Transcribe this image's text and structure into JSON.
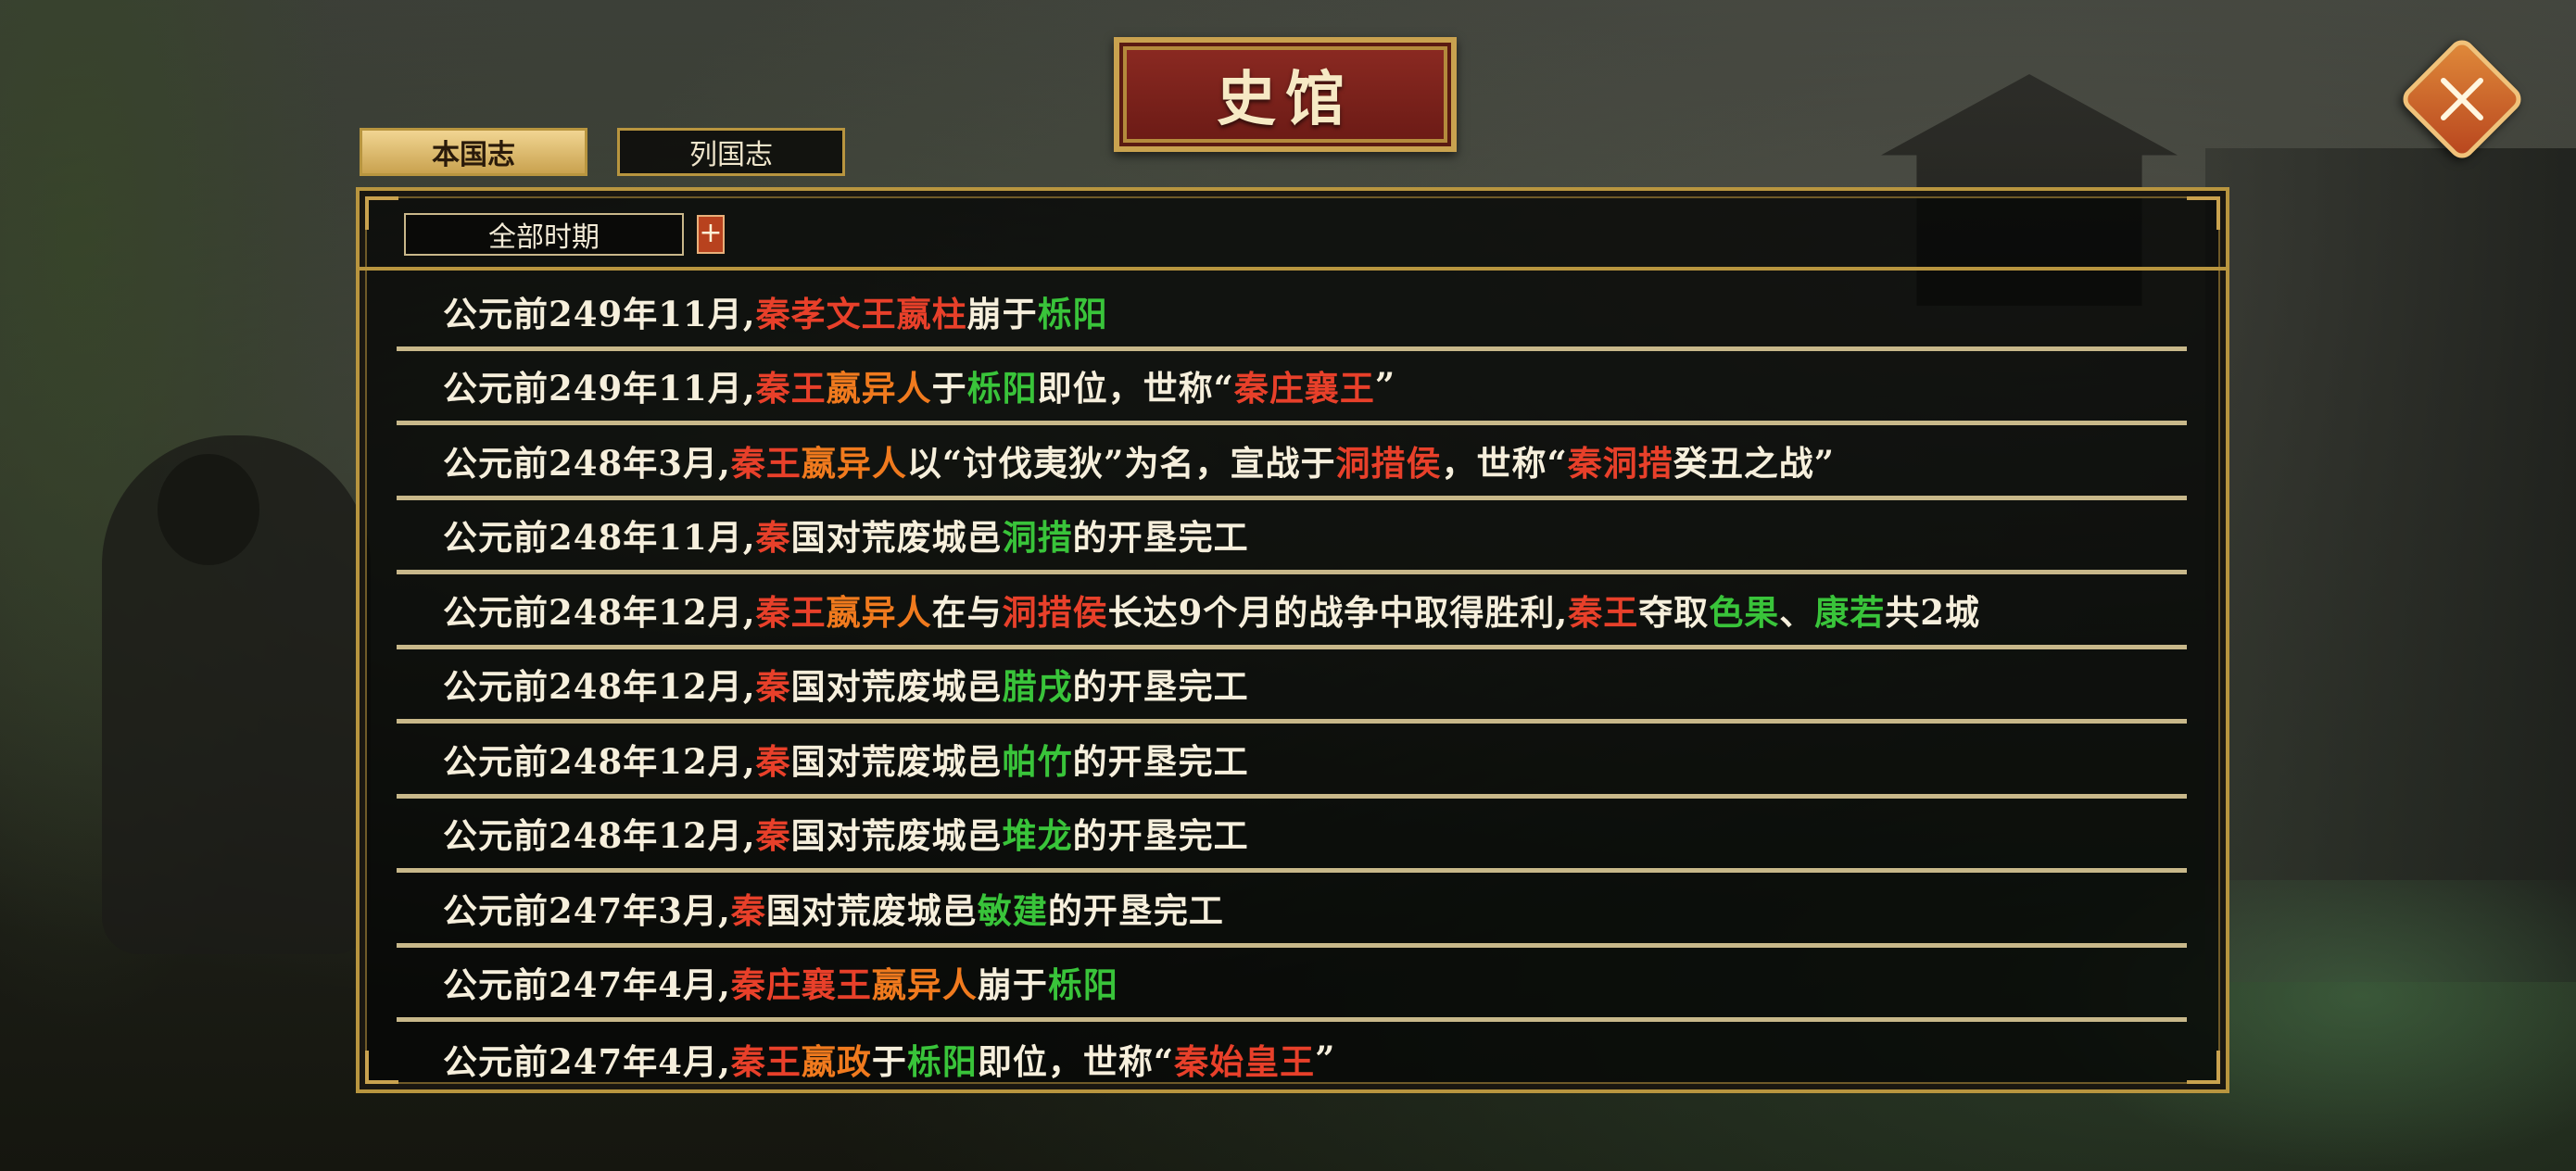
{
  "title": "史馆",
  "tabs": [
    {
      "label": "本国志",
      "active": true
    },
    {
      "label": "列国志",
      "active": false
    }
  ],
  "filter": {
    "period_label": "全部时期",
    "expand_label": "+"
  },
  "colors": {
    "white": "#f6efdc",
    "red": "#e8402a",
    "orange": "#f07a1e",
    "green": "#39c43a",
    "gold": "#b8953f"
  },
  "entries": [
    [
      {
        "t": "公元前249年11月,",
        "c": "w"
      },
      {
        "t": "秦孝文王嬴柱",
        "c": "r"
      },
      {
        "t": "崩于",
        "c": "w"
      },
      {
        "t": "栎阳",
        "c": "g"
      }
    ],
    [
      {
        "t": "公元前249年11月,",
        "c": "w"
      },
      {
        "t": "秦王",
        "c": "r"
      },
      {
        "t": "嬴异人",
        "c": "o"
      },
      {
        "t": "于",
        "c": "w"
      },
      {
        "t": "栎阳",
        "c": "g"
      },
      {
        "t": "即位，世称“",
        "c": "w"
      },
      {
        "t": "秦庄襄王",
        "c": "r"
      },
      {
        "t": "”",
        "c": "w"
      }
    ],
    [
      {
        "t": "公元前248年3月,",
        "c": "w"
      },
      {
        "t": "秦王",
        "c": "r"
      },
      {
        "t": "嬴异人",
        "c": "o"
      },
      {
        "t": "以“讨伐夷狄”为名，宣战于",
        "c": "w"
      },
      {
        "t": "洞措侯",
        "c": "r"
      },
      {
        "t": "，世称“",
        "c": "w"
      },
      {
        "t": "秦洞措",
        "c": "r"
      },
      {
        "t": "癸丑之战”",
        "c": "w"
      }
    ],
    [
      {
        "t": "公元前248年11月,",
        "c": "w"
      },
      {
        "t": "秦",
        "c": "r"
      },
      {
        "t": "国对荒废城邑",
        "c": "w"
      },
      {
        "t": "洞措",
        "c": "g"
      },
      {
        "t": "的开垦完工",
        "c": "w"
      }
    ],
    [
      {
        "t": "公元前248年12月,",
        "c": "w"
      },
      {
        "t": "秦王",
        "c": "r"
      },
      {
        "t": "嬴异人",
        "c": "o"
      },
      {
        "t": "在与",
        "c": "w"
      },
      {
        "t": "洞措侯",
        "c": "r"
      },
      {
        "t": "长达9个月的战争中取得胜利,",
        "c": "w"
      },
      {
        "t": "秦王",
        "c": "r"
      },
      {
        "t": "夺取",
        "c": "w"
      },
      {
        "t": "色果",
        "c": "g"
      },
      {
        "t": "、",
        "c": "w"
      },
      {
        "t": "康若",
        "c": "g"
      },
      {
        "t": "共2城",
        "c": "w"
      }
    ],
    [
      {
        "t": "公元前248年12月,",
        "c": "w"
      },
      {
        "t": "秦",
        "c": "r"
      },
      {
        "t": "国对荒废城邑",
        "c": "w"
      },
      {
        "t": "腊戌",
        "c": "g"
      },
      {
        "t": "的开垦完工",
        "c": "w"
      }
    ],
    [
      {
        "t": "公元前248年12月,",
        "c": "w"
      },
      {
        "t": "秦",
        "c": "r"
      },
      {
        "t": "国对荒废城邑",
        "c": "w"
      },
      {
        "t": "帕竹",
        "c": "g"
      },
      {
        "t": "的开垦完工",
        "c": "w"
      }
    ],
    [
      {
        "t": "公元前248年12月,",
        "c": "w"
      },
      {
        "t": "秦",
        "c": "r"
      },
      {
        "t": "国对荒废城邑",
        "c": "w"
      },
      {
        "t": "堆龙",
        "c": "g"
      },
      {
        "t": "的开垦完工",
        "c": "w"
      }
    ],
    [
      {
        "t": "公元前247年3月,",
        "c": "w"
      },
      {
        "t": "秦",
        "c": "r"
      },
      {
        "t": "国对荒废城邑",
        "c": "w"
      },
      {
        "t": "敏建",
        "c": "g"
      },
      {
        "t": "的开垦完工",
        "c": "w"
      }
    ],
    [
      {
        "t": "公元前247年4月,",
        "c": "w"
      },
      {
        "t": "秦庄襄王",
        "c": "r"
      },
      {
        "t": "嬴异人",
        "c": "o"
      },
      {
        "t": "崩于",
        "c": "w"
      },
      {
        "t": "栎阳",
        "c": "g"
      }
    ],
    [
      {
        "t": "公元前247年4月,",
        "c": "w"
      },
      {
        "t": "秦王",
        "c": "r"
      },
      {
        "t": "嬴政",
        "c": "o"
      },
      {
        "t": "于",
        "c": "w"
      },
      {
        "t": "栎阳",
        "c": "g"
      },
      {
        "t": "即位，世称“",
        "c": "w"
      },
      {
        "t": "秦始皇王",
        "c": "r"
      },
      {
        "t": "”",
        "c": "w"
      }
    ]
  ]
}
